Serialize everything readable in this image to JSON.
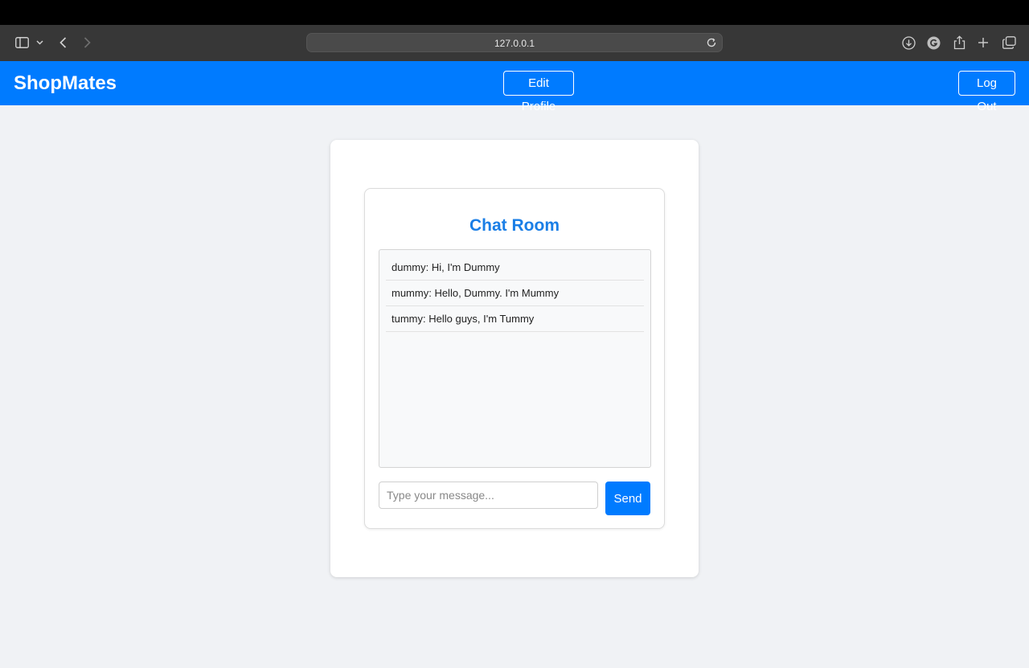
{
  "browser": {
    "url": "127.0.0.1",
    "icons": [
      "sidebar-icon",
      "chevron-down-icon",
      "back-icon",
      "forward-icon",
      "reload-icon",
      "download-icon",
      "grammarly-icon",
      "share-icon",
      "new-tab-icon",
      "tabs-overview-icon"
    ]
  },
  "navbar": {
    "brand": "ShopMates",
    "edit_profile_label": "Edit Profile",
    "logout_label": "Log Out",
    "color": "#007bff"
  },
  "chat": {
    "title": "Chat Room",
    "messages": [
      {
        "text": "dummy: Hi, I'm Dummy"
      },
      {
        "text": "mummy: Hello, Dummy. I'm Mummy"
      },
      {
        "text": "tummy: Hello guys, I'm Tummy"
      }
    ],
    "input_value": "",
    "input_placeholder": "Type your message...",
    "send_label": "Send"
  }
}
